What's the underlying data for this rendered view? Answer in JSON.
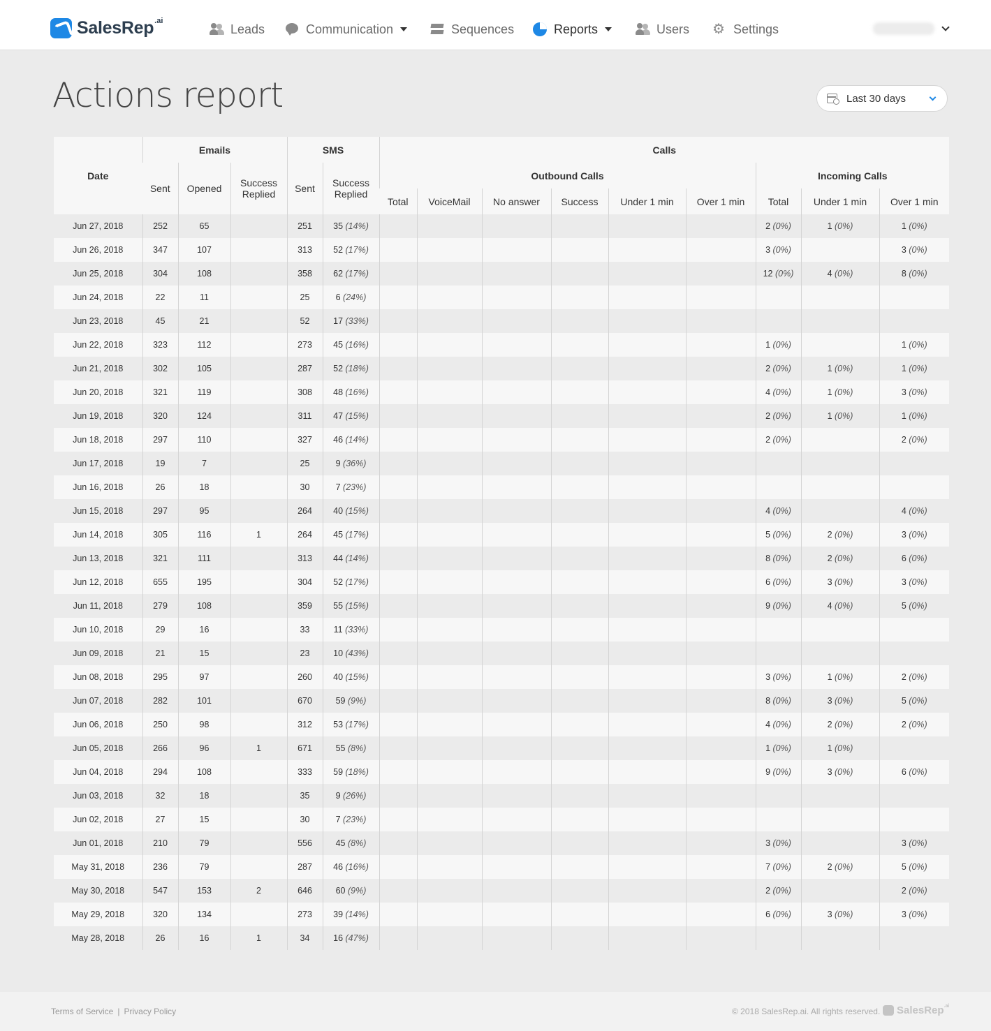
{
  "brand": {
    "name": "SalesRep",
    "suffix": ".ai"
  },
  "nav": {
    "leads": "Leads",
    "communication": "Communication",
    "sequences": "Sequences",
    "reports": "Reports",
    "users": "Users",
    "settings": "Settings"
  },
  "page": {
    "title": "Actions report"
  },
  "date_range": {
    "selected": "Last 30 days"
  },
  "table": {
    "headers": {
      "date": "Date",
      "emails": "Emails",
      "sms": "SMS",
      "calls": "Calls",
      "outbound": "Outbound Calls",
      "incoming": "Incoming Calls",
      "email_sent": "Sent",
      "email_opened": "Opened",
      "email_success": "Success Replied",
      "sms_sent": "Sent",
      "sms_success": "Success Replied",
      "out_total": "Total",
      "out_voicemail": "VoiceMail",
      "out_noanswer": "No answer",
      "out_success": "Success",
      "out_under": "Under 1 min",
      "out_over": "Over 1 min",
      "in_total": "Total",
      "in_under": "Under 1 min",
      "in_over": "Over 1 min"
    },
    "rows": [
      {
        "date": "Jun 27, 2018",
        "es": "252",
        "eo": "65",
        "er": "",
        "ss": "251",
        "sr": "35",
        "srp": "(14%)",
        "it": "2",
        "itp": "(0%)",
        "iu": "1",
        "iup": "(0%)",
        "io": "1",
        "iop": "(0%)"
      },
      {
        "date": "Jun 26, 2018",
        "es": "347",
        "eo": "107",
        "er": "",
        "ss": "313",
        "sr": "52",
        "srp": "(17%)",
        "it": "3",
        "itp": "(0%)",
        "iu": "",
        "iup": "",
        "io": "3",
        "iop": "(0%)"
      },
      {
        "date": "Jun 25, 2018",
        "es": "304",
        "eo": "108",
        "er": "",
        "ss": "358",
        "sr": "62",
        "srp": "(17%)",
        "it": "12",
        "itp": "(0%)",
        "iu": "4",
        "iup": "(0%)",
        "io": "8",
        "iop": "(0%)"
      },
      {
        "date": "Jun 24, 2018",
        "es": "22",
        "eo": "11",
        "er": "",
        "ss": "25",
        "sr": "6",
        "srp": "(24%)",
        "it": "",
        "itp": "",
        "iu": "",
        "iup": "",
        "io": "",
        "iop": ""
      },
      {
        "date": "Jun 23, 2018",
        "es": "45",
        "eo": "21",
        "er": "",
        "ss": "52",
        "sr": "17",
        "srp": "(33%)",
        "it": "",
        "itp": "",
        "iu": "",
        "iup": "",
        "io": "",
        "iop": ""
      },
      {
        "date": "Jun 22, 2018",
        "es": "323",
        "eo": "112",
        "er": "",
        "ss": "273",
        "sr": "45",
        "srp": "(16%)",
        "it": "1",
        "itp": "(0%)",
        "iu": "",
        "iup": "",
        "io": "1",
        "iop": "(0%)"
      },
      {
        "date": "Jun 21, 2018",
        "es": "302",
        "eo": "105",
        "er": "",
        "ss": "287",
        "sr": "52",
        "srp": "(18%)",
        "it": "2",
        "itp": "(0%)",
        "iu": "1",
        "iup": "(0%)",
        "io": "1",
        "iop": "(0%)"
      },
      {
        "date": "Jun 20, 2018",
        "es": "321",
        "eo": "119",
        "er": "",
        "ss": "308",
        "sr": "48",
        "srp": "(16%)",
        "it": "4",
        "itp": "(0%)",
        "iu": "1",
        "iup": "(0%)",
        "io": "3",
        "iop": "(0%)"
      },
      {
        "date": "Jun 19, 2018",
        "es": "320",
        "eo": "124",
        "er": "",
        "ss": "311",
        "sr": "47",
        "srp": "(15%)",
        "it": "2",
        "itp": "(0%)",
        "iu": "1",
        "iup": "(0%)",
        "io": "1",
        "iop": "(0%)"
      },
      {
        "date": "Jun 18, 2018",
        "es": "297",
        "eo": "110",
        "er": "",
        "ss": "327",
        "sr": "46",
        "srp": "(14%)",
        "it": "2",
        "itp": "(0%)",
        "iu": "",
        "iup": "",
        "io": "2",
        "iop": "(0%)"
      },
      {
        "date": "Jun 17, 2018",
        "es": "19",
        "eo": "7",
        "er": "",
        "ss": "25",
        "sr": "9",
        "srp": "(36%)",
        "it": "",
        "itp": "",
        "iu": "",
        "iup": "",
        "io": "",
        "iop": ""
      },
      {
        "date": "Jun 16, 2018",
        "es": "26",
        "eo": "18",
        "er": "",
        "ss": "30",
        "sr": "7",
        "srp": "(23%)",
        "it": "",
        "itp": "",
        "iu": "",
        "iup": "",
        "io": "",
        "iop": ""
      },
      {
        "date": "Jun 15, 2018",
        "es": "297",
        "eo": "95",
        "er": "",
        "ss": "264",
        "sr": "40",
        "srp": "(15%)",
        "it": "4",
        "itp": "(0%)",
        "iu": "",
        "iup": "",
        "io": "4",
        "iop": "(0%)"
      },
      {
        "date": "Jun 14, 2018",
        "es": "305",
        "eo": "116",
        "er": "1",
        "ss": "264",
        "sr": "45",
        "srp": "(17%)",
        "it": "5",
        "itp": "(0%)",
        "iu": "2",
        "iup": "(0%)",
        "io": "3",
        "iop": "(0%)"
      },
      {
        "date": "Jun 13, 2018",
        "es": "321",
        "eo": "111",
        "er": "",
        "ss": "313",
        "sr": "44",
        "srp": "(14%)",
        "it": "8",
        "itp": "(0%)",
        "iu": "2",
        "iup": "(0%)",
        "io": "6",
        "iop": "(0%)"
      },
      {
        "date": "Jun 12, 2018",
        "es": "655",
        "eo": "195",
        "er": "",
        "ss": "304",
        "sr": "52",
        "srp": "(17%)",
        "it": "6",
        "itp": "(0%)",
        "iu": "3",
        "iup": "(0%)",
        "io": "3",
        "iop": "(0%)"
      },
      {
        "date": "Jun 11, 2018",
        "es": "279",
        "eo": "108",
        "er": "",
        "ss": "359",
        "sr": "55",
        "srp": "(15%)",
        "it": "9",
        "itp": "(0%)",
        "iu": "4",
        "iup": "(0%)",
        "io": "5",
        "iop": "(0%)"
      },
      {
        "date": "Jun 10, 2018",
        "es": "29",
        "eo": "16",
        "er": "",
        "ss": "33",
        "sr": "11",
        "srp": "(33%)",
        "it": "",
        "itp": "",
        "iu": "",
        "iup": "",
        "io": "",
        "iop": ""
      },
      {
        "date": "Jun 09, 2018",
        "es": "21",
        "eo": "15",
        "er": "",
        "ss": "23",
        "sr": "10",
        "srp": "(43%)",
        "it": "",
        "itp": "",
        "iu": "",
        "iup": "",
        "io": "",
        "iop": ""
      },
      {
        "date": "Jun 08, 2018",
        "es": "295",
        "eo": "97",
        "er": "",
        "ss": "260",
        "sr": "40",
        "srp": "(15%)",
        "it": "3",
        "itp": "(0%)",
        "iu": "1",
        "iup": "(0%)",
        "io": "2",
        "iop": "(0%)"
      },
      {
        "date": "Jun 07, 2018",
        "es": "282",
        "eo": "101",
        "er": "",
        "ss": "670",
        "sr": "59",
        "srp": "(9%)",
        "it": "8",
        "itp": "(0%)",
        "iu": "3",
        "iup": "(0%)",
        "io": "5",
        "iop": "(0%)"
      },
      {
        "date": "Jun 06, 2018",
        "es": "250",
        "eo": "98",
        "er": "",
        "ss": "312",
        "sr": "53",
        "srp": "(17%)",
        "it": "4",
        "itp": "(0%)",
        "iu": "2",
        "iup": "(0%)",
        "io": "2",
        "iop": "(0%)"
      },
      {
        "date": "Jun 05, 2018",
        "es": "266",
        "eo": "96",
        "er": "1",
        "ss": "671",
        "sr": "55",
        "srp": "(8%)",
        "it": "1",
        "itp": "(0%)",
        "iu": "1",
        "iup": "(0%)",
        "io": "",
        "iop": ""
      },
      {
        "date": "Jun 04, 2018",
        "es": "294",
        "eo": "108",
        "er": "",
        "ss": "333",
        "sr": "59",
        "srp": "(18%)",
        "it": "9",
        "itp": "(0%)",
        "iu": "3",
        "iup": "(0%)",
        "io": "6",
        "iop": "(0%)"
      },
      {
        "date": "Jun 03, 2018",
        "es": "32",
        "eo": "18",
        "er": "",
        "ss": "35",
        "sr": "9",
        "srp": "(26%)",
        "it": "",
        "itp": "",
        "iu": "",
        "iup": "",
        "io": "",
        "iop": ""
      },
      {
        "date": "Jun 02, 2018",
        "es": "27",
        "eo": "15",
        "er": "",
        "ss": "30",
        "sr": "7",
        "srp": "(23%)",
        "it": "",
        "itp": "",
        "iu": "",
        "iup": "",
        "io": "",
        "iop": ""
      },
      {
        "date": "Jun 01, 2018",
        "es": "210",
        "eo": "79",
        "er": "",
        "ss": "556",
        "sr": "45",
        "srp": "(8%)",
        "it": "3",
        "itp": "(0%)",
        "iu": "",
        "iup": "",
        "io": "3",
        "iop": "(0%)"
      },
      {
        "date": "May 31, 2018",
        "es": "236",
        "eo": "79",
        "er": "",
        "ss": "287",
        "sr": "46",
        "srp": "(16%)",
        "it": "7",
        "itp": "(0%)",
        "iu": "2",
        "iup": "(0%)",
        "io": "5",
        "iop": "(0%)"
      },
      {
        "date": "May 30, 2018",
        "es": "547",
        "eo": "153",
        "er": "2",
        "ss": "646",
        "sr": "60",
        "srp": "(9%)",
        "it": "2",
        "itp": "(0%)",
        "iu": "",
        "iup": "",
        "io": "2",
        "iop": "(0%)"
      },
      {
        "date": "May 29, 2018",
        "es": "320",
        "eo": "134",
        "er": "",
        "ss": "273",
        "sr": "39",
        "srp": "(14%)",
        "it": "6",
        "itp": "(0%)",
        "iu": "3",
        "iup": "(0%)",
        "io": "3",
        "iop": "(0%)"
      },
      {
        "date": "May 28, 2018",
        "es": "26",
        "eo": "16",
        "er": "1",
        "ss": "34",
        "sr": "16",
        "srp": "(47%)",
        "it": "",
        "itp": "",
        "iu": "",
        "iup": "",
        "io": "",
        "iop": ""
      }
    ]
  },
  "footer": {
    "terms": "Terms of Service",
    "separator": "|",
    "privacy": "Privacy Policy",
    "copyright": "© 2018 SalesRep.ai. All rights reserved.",
    "logo_text": "SalesRep",
    "logo_suffix": ".ai"
  },
  "colors": {
    "accent": "#1e88e5",
    "background": "#ebebeb"
  }
}
